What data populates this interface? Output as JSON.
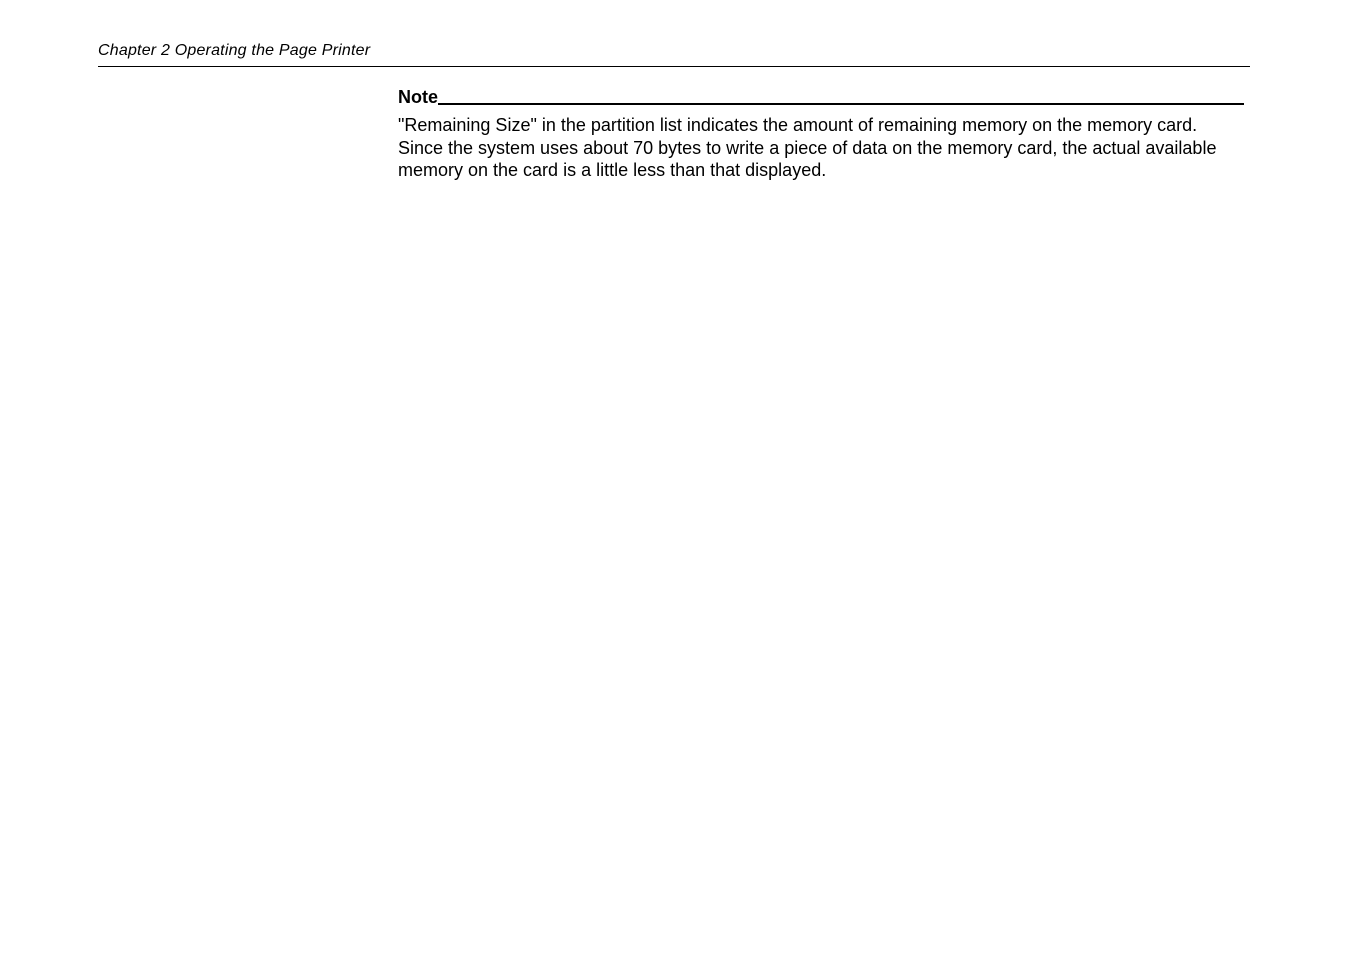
{
  "header": {
    "chapter_header": "Chapter 2  Operating the Page Printer"
  },
  "content": {
    "note_label": "Note",
    "note_body": "\"Remaining Size\" in the partition list indicates the amount of remaining memory on the memory card. Since the system uses about 70 bytes to write a piece of data on the memory card, the actual available memory on the card is a little less than that displayed."
  }
}
